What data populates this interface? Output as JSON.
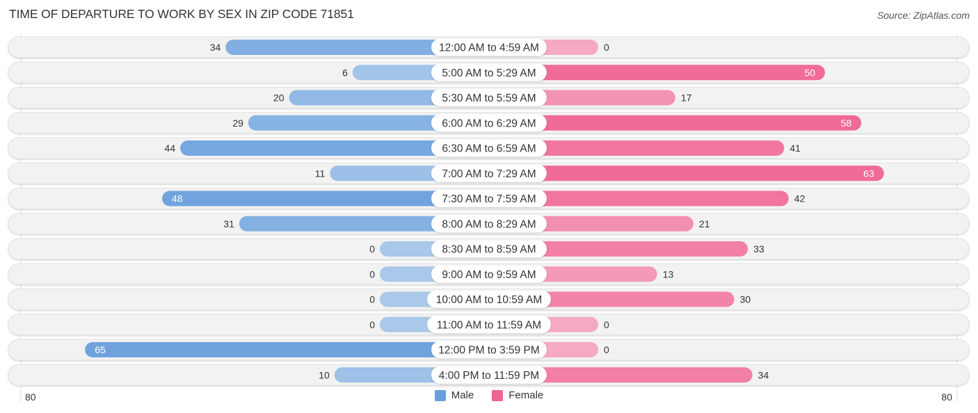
{
  "title": "TIME OF DEPARTURE TO WORK BY SEX IN ZIP CODE 71851",
  "source": "Source: ZipAtlas.com",
  "colors": {
    "male": "#6fa3dd",
    "male_light": "#a9c8ea",
    "female": "#f06b96",
    "female_light": "#f5a9c2",
    "track": "#f2f2f2",
    "label_bg": "#ffffff"
  },
  "legend": [
    {
      "name": "Male",
      "color": "#6a9fdb"
    },
    {
      "name": "Female",
      "color": "#f0628f"
    }
  ],
  "axis": {
    "left_label": "80",
    "right_label": "80"
  },
  "chart_data": {
    "type": "bar",
    "orientation": "horizontal-diverging",
    "title": "TIME OF DEPARTURE TO WORK BY SEX IN ZIP CODE 71851",
    "categories": [
      "12:00 AM to 4:59 AM",
      "5:00 AM to 5:29 AM",
      "5:30 AM to 5:59 AM",
      "6:00 AM to 6:29 AM",
      "6:30 AM to 6:59 AM",
      "7:00 AM to 7:29 AM",
      "7:30 AM to 7:59 AM",
      "8:00 AM to 8:29 AM",
      "8:30 AM to 8:59 AM",
      "9:00 AM to 9:59 AM",
      "10:00 AM to 10:59 AM",
      "11:00 AM to 11:59 AM",
      "12:00 PM to 3:59 PM",
      "4:00 PM to 11:59 PM"
    ],
    "series": [
      {
        "name": "Male",
        "side": "left",
        "values": [
          34,
          6,
          20,
          29,
          44,
          11,
          48,
          31,
          0,
          0,
          0,
          0,
          65,
          10
        ]
      },
      {
        "name": "Female",
        "side": "right",
        "values": [
          0,
          50,
          17,
          58,
          41,
          63,
          42,
          21,
          33,
          13,
          30,
          0,
          0,
          34
        ]
      }
    ],
    "xlim": [
      -80,
      80
    ],
    "xlabel": "",
    "ylabel": "",
    "legend_position": "bottom-center",
    "grid": false
  }
}
